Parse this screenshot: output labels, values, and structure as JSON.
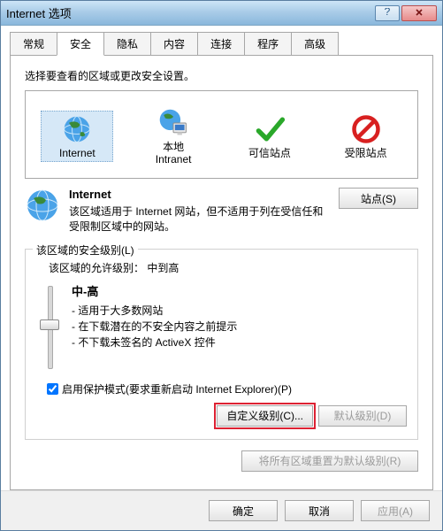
{
  "window": {
    "title": "Internet 选项"
  },
  "tabs": [
    "常规",
    "安全",
    "隐私",
    "内容",
    "连接",
    "程序",
    "高级"
  ],
  "active_tab_index": 1,
  "instruction": "选择要查看的区域或更改安全设置。",
  "zones": [
    {
      "label": "Internet",
      "icon": "globe"
    },
    {
      "label": "本地\nIntranet",
      "icon": "globe-monitor"
    },
    {
      "label": "可信站点",
      "icon": "check"
    },
    {
      "label": "受限站点",
      "icon": "forbidden"
    }
  ],
  "zone_detail": {
    "name": "Internet",
    "description": "该区域适用于 Internet 网站，但不适用于列在受信任和受限制区域中的网站。",
    "sites_button": "站点(S)"
  },
  "security_group": {
    "legend": "该区域的安全级别(L)",
    "allowed_label": "该区域的允许级别：",
    "allowed_value": "中到高",
    "level_name": "中-高",
    "bullets": [
      "适用于大多数网站",
      "在下载潜在的不安全内容之前提示",
      "不下载未签名的 ActiveX 控件"
    ],
    "protected_mode_label": "启用保护模式(要求重新启动 Internet Explorer)(P)",
    "protected_mode_checked": true,
    "custom_level_button": "自定义级别(C)...",
    "default_level_button": "默认级别(D)",
    "reset_button": "将所有区域重置为默认级别(R)"
  },
  "footer": {
    "ok": "确定",
    "cancel": "取消",
    "apply": "应用(A)"
  }
}
